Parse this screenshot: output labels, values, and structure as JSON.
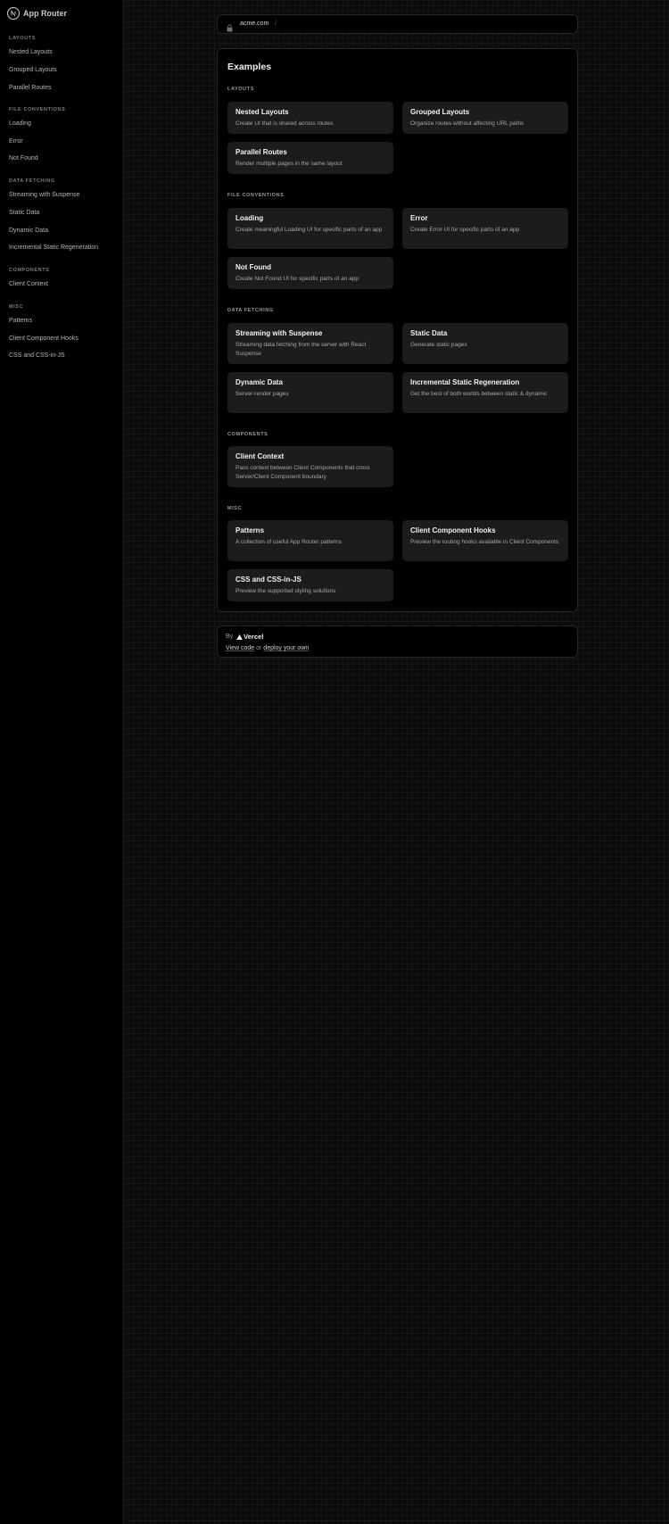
{
  "brand": {
    "title": "App Router",
    "logo_icon": "nextjs-logo-icon"
  },
  "sidebar": {
    "sections": [
      {
        "heading": "Layouts",
        "items": [
          "Nested Layouts",
          "Grouped Layouts",
          "Parallel Routes"
        ]
      },
      {
        "heading": "File Conventions",
        "items": [
          "Loading",
          "Error",
          "Not Found"
        ]
      },
      {
        "heading": "Data Fetching",
        "items": [
          "Streaming with Suspense",
          "Static Data",
          "Dynamic Data",
          "Incremental Static Regeneration"
        ]
      },
      {
        "heading": "Components",
        "items": [
          "Client Context"
        ]
      },
      {
        "heading": "Misc",
        "items": [
          "Patterns",
          "Client Component Hooks",
          "CSS and CSS-in-JS"
        ]
      }
    ]
  },
  "url_bar": {
    "domain": "acme.com",
    "separator": "/",
    "icon": "lock-icon"
  },
  "main": {
    "title": "Examples",
    "sections": [
      {
        "heading": "Layouts",
        "cards": [
          {
            "title": "Nested Layouts",
            "desc": "Create UI that is shared across routes"
          },
          {
            "title": "Grouped Layouts",
            "desc": "Organize routes without affecting URL paths"
          },
          {
            "title": "Parallel Routes",
            "desc": "Render multiple pages in the same layout"
          }
        ]
      },
      {
        "heading": "File Conventions",
        "cards": [
          {
            "title": "Loading",
            "desc": "Create meaningful Loading UI for specific parts of an app"
          },
          {
            "title": "Error",
            "desc": "Create Error UI for specific parts of an app"
          },
          {
            "title": "Not Found",
            "desc": "Create Not Found UI for specific parts of an app"
          }
        ]
      },
      {
        "heading": "Data Fetching",
        "cards": [
          {
            "title": "Streaming with Suspense",
            "desc": "Streaming data fetching from the server with React Suspense"
          },
          {
            "title": "Static Data",
            "desc": "Generate static pages"
          },
          {
            "title": "Dynamic Data",
            "desc": "Server-render pages"
          },
          {
            "title": "Incremental Static Regeneration",
            "desc": "Get the best of both worlds between static & dynamic"
          }
        ]
      },
      {
        "heading": "Components",
        "cards": [
          {
            "title": "Client Context",
            "desc": "Pass context between Client Components that cross Server/Client Component boundary"
          }
        ]
      },
      {
        "heading": "Misc",
        "cards": [
          {
            "title": "Patterns",
            "desc": "A collection of useful App Router patterns"
          },
          {
            "title": "Client Component Hooks",
            "desc": "Preview the routing hooks available in Client Components"
          },
          {
            "title": "CSS and CSS-in-JS",
            "desc": "Preview the supported styling solutions"
          }
        ]
      }
    ]
  },
  "footer": {
    "by": "By",
    "vercel": "Vercel",
    "view_code": "View code",
    "or": " or ",
    "deploy": "deploy your own"
  },
  "colors": {
    "background": "#0b0b0b",
    "card": "#1c1c1e",
    "border": "#262626"
  }
}
